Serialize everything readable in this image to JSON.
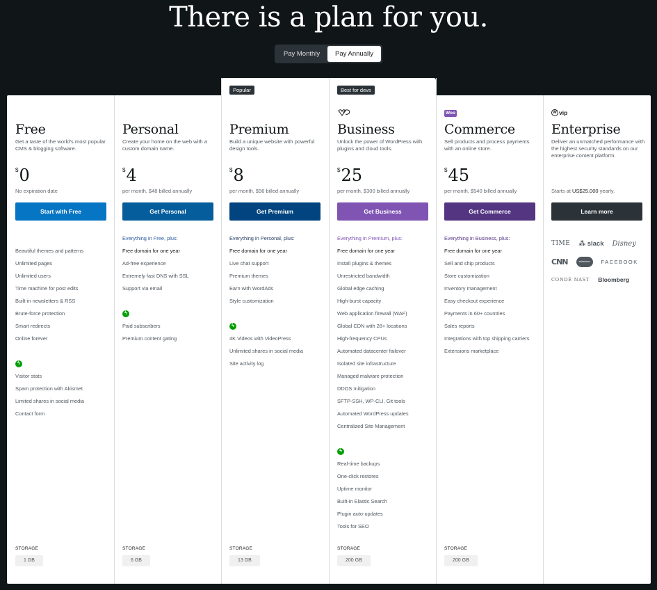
{
  "headline": "There is a plan for you.",
  "billing_toggle": {
    "options": [
      "Pay Monthly",
      "Pay Annually"
    ],
    "selected": "Pay Annually"
  },
  "colors": {
    "free": "#0675c4",
    "personal": "#055d9c",
    "premium": "#01447f",
    "business": "#7f54b3",
    "commerce": "#533582",
    "enterprise": "#2c3338",
    "jetpack": "#069e08"
  },
  "plans": [
    {
      "name": "Free",
      "description": "Get a taste of the world's most popular CMS & blogging software.",
      "currency": "$",
      "price": "0",
      "price_note": "No expiration date",
      "cta": "Start with Free",
      "features_heading": "",
      "features": [
        "Beautiful themes and patterns",
        "Unlimited pages",
        "Unlimited users",
        "Time machine for post edits",
        "Built-in newsletters & RSS",
        "Brute-force protection",
        "Smart redirects",
        "Online forever"
      ],
      "jetpack_features": [
        "Visitor stats",
        "Spam protection with Akismet",
        "Limited shares in social media",
        "Contact form"
      ],
      "storage_label": "STORAGE",
      "storage": "1 GB"
    },
    {
      "name": "Personal",
      "description": "Create your home on the web with a custom domain name.",
      "currency": "$",
      "price": "4",
      "price_note": "per month, $48 billed annually",
      "cta": "Get Personal",
      "features_heading": "Everything in Free, plus:",
      "highlight": "Free domain for one year",
      "features": [
        "Ad-free experience",
        "Extremely fast DNS with SSL",
        "Support via email"
      ],
      "jetpack_features": [
        "Paid subscribers",
        "Premium content gating"
      ],
      "storage_label": "STORAGE",
      "storage": "6 GB"
    },
    {
      "name": "Premium",
      "badge": "Popular",
      "description": "Build a unique website with powerful design tools.",
      "currency": "$",
      "price": "8",
      "price_note": "per month, $96 billed annually",
      "cta": "Get Premium",
      "features_heading": "Everything in Personal, plus:",
      "highlight": "Free domain for one year",
      "features": [
        "Live chat support",
        "Premium themes",
        "Earn with WordAds",
        "Style customization"
      ],
      "jetpack_features": [
        "4K Videos with VideoPress",
        "Unlimited shares in social media",
        "Site activity log"
      ],
      "storage_label": "STORAGE",
      "storage": "13 GB"
    },
    {
      "name": "Business",
      "badge": "Best for devs",
      "logo": "wp-cloud-logo",
      "description": "Unlock the power of WordPress with plugins and cloud tools.",
      "currency": "$",
      "price": "25",
      "price_note": "per month, $300 billed annually",
      "cta": "Get Business",
      "features_heading": "Everything in Premium, plus:",
      "highlight": "Free domain for one year",
      "features": [
        "Install plugins & themes",
        "Unrestricted bandwidth",
        "Global edge caching",
        "High-burst capacity",
        "Web application firewall (WAF)",
        "Global CDN with 28+ locations",
        "High-frequency CPUs",
        "Automated datacenter failover",
        "Isolated site infrastructure",
        "Managed malware protection",
        "DDOS mitigation",
        "SFTP-SSH, WP-CLI, Git tools",
        "Automated WordPress updates",
        "Centralized Site Management"
      ],
      "jetpack_features": [
        "Real-time backups",
        "One-click restores",
        "Uptime monitor",
        "Built-in Elastic Search",
        "Plugin auto-updates",
        "Tools for SEO"
      ],
      "storage_label": "STORAGE",
      "storage": "200 GB"
    },
    {
      "name": "Commerce",
      "logo": "Woo",
      "description": "Sell products and process payments with an online store.",
      "currency": "$",
      "price": "45",
      "price_note": "per month, $540 billed annually",
      "cta": "Get Commerce",
      "features_heading": "Everything in Business, plus:",
      "highlight": "Free domain for one year",
      "features": [
        "Sell and ship products",
        "Store customization",
        "Inventory management",
        "Easy checkout experience",
        "Payments in 60+ countries",
        "Sales reports",
        "Integrations with top shipping carriers",
        "Extensions marketplace"
      ],
      "storage_label": "STORAGE",
      "storage": "200 GB"
    },
    {
      "name": "Enterprise",
      "logo": "vip",
      "description": "Deliver an unmatched performance with the highest security standards on our enterprise content platform.",
      "price_note_prefix": "Starts at ",
      "price_note_amount": "US$25,000",
      "price_note_suffix": " yearly.",
      "cta": "Learn more",
      "clients": [
        "TIME",
        "slack",
        "Disney",
        "CNN",
        "salesforce",
        "FACEBOOK",
        "CONDÉ NAST",
        "Bloomberg"
      ]
    }
  ]
}
